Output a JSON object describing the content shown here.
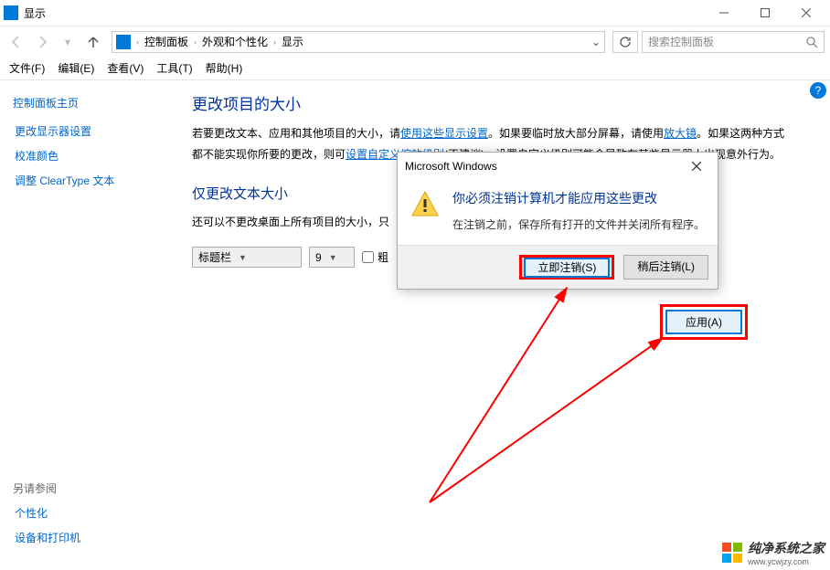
{
  "window": {
    "title": "显示"
  },
  "winbuttons": {
    "min": "—",
    "max": "☐",
    "close": "✕"
  },
  "breadcrumbs": {
    "b1": "控制面板",
    "b2": "外观和个性化",
    "b3": "显示"
  },
  "search": {
    "placeholder": "搜索控制面板"
  },
  "menu": {
    "file": "文件(F)",
    "edit": "编辑(E)",
    "view": "查看(V)",
    "tools": "工具(T)",
    "help": "帮助(H)"
  },
  "sidebar": {
    "home": "控制面板主页",
    "link1": "更改显示器设置",
    "link2": "校准颜色",
    "link3": "调整 ClearType 文本",
    "seealso": "另请参阅",
    "sa1": "个性化",
    "sa2": "设备和打印机"
  },
  "main": {
    "h1": "更改项目的大小",
    "p1a": "若要更改文本、应用和其他项目的大小，请",
    "p1link1": "使用这些显示设置",
    "p1b": "。如果要临时放大部分屏幕，请使用",
    "p1link2": "放大镜",
    "p1c": "。如果这两种方式都不能实现你所要的更改，则可",
    "p1link3": "设置自定义缩放级别",
    "p1d": "(不建议)。设置自定义级别可能会导致在某些显示器上出现意外行为。",
    "h2": "仅更改文本大小",
    "p2": "还可以不更改桌面上所有项目的大小，只",
    "select1": "标题栏",
    "select2": "9",
    "checkbox": "粗",
    "apply": "应用(A)"
  },
  "dialog": {
    "title": "Microsoft Windows",
    "msg": "你必须注销计算机才能应用这些更改",
    "sub": "在注销之前，保存所有打开的文件并关闭所有程序。",
    "btn1": "立即注销(S)",
    "btn2": "稍后注销(L)"
  },
  "help": "?",
  "watermark": {
    "text": "纯净系统之家",
    "url": "www.ycwjzy.com"
  }
}
